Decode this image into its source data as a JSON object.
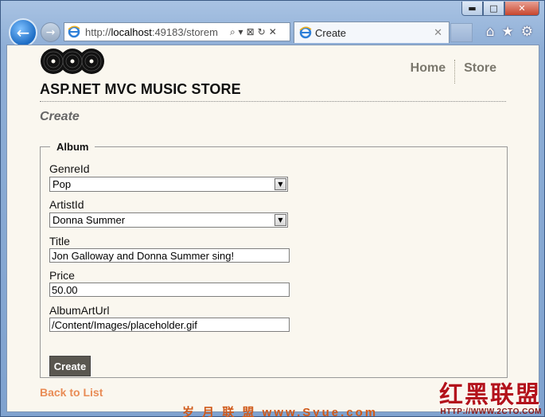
{
  "browser": {
    "url_prefix": "http://",
    "url_host": "localhost",
    "url_rest": ":49183/storem",
    "tab_title": "Create",
    "caption_min": "▬",
    "caption_max": "□",
    "caption_close": "✕",
    "tools": [
      "⌕ ▾",
      "⊠",
      "↻",
      "✕"
    ],
    "right_tools": [
      "⌂",
      "★",
      "⚙"
    ]
  },
  "site": {
    "title": "ASP.NET MVC MUSIC STORE",
    "nav": [
      "Home",
      "Store"
    ]
  },
  "page": {
    "heading": "Create",
    "legend": "Album",
    "fields": {
      "genre_label": "GenreId",
      "genre_value": "Pop",
      "artist_label": "ArtistId",
      "artist_value": "Donna Summer",
      "title_label": "Title",
      "title_value": "Jon Galloway and Donna Summer sing!",
      "price_label": "Price",
      "price_value": "50.00",
      "art_label": "AlbumArtUrl",
      "art_value": "/Content/Images/placeholder.gif"
    },
    "submit_label": "Create",
    "back_link": "Back to List"
  },
  "watermarks": {
    "cn_site": "岁 月 联 盟   www.Syue.com",
    "cn_brand": "红黑联盟",
    "url": "HTTP://WWW.2CTO.COM"
  },
  "colors": {
    "page_bg": "#faf7ef",
    "nav_link": "#7a776c",
    "back_link": "#e98c56",
    "button_bg": "#5a5750"
  }
}
